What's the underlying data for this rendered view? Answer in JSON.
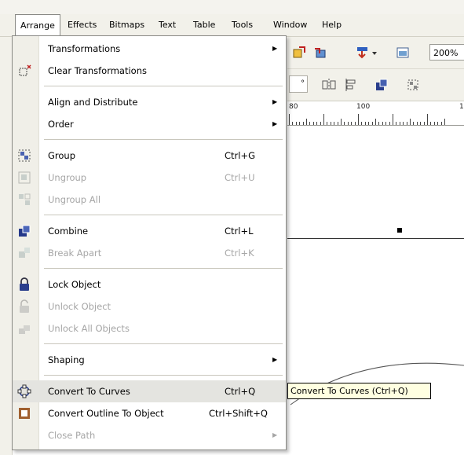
{
  "menubar": {
    "items": [
      {
        "label": "Arrange",
        "active": true
      },
      {
        "label": "Effects",
        "active": false
      },
      {
        "label": "Bitmaps",
        "active": false
      },
      {
        "label": "Text",
        "active": false
      },
      {
        "label": "Table",
        "active": false
      },
      {
        "label": "Tools",
        "active": false
      },
      {
        "label": "Window",
        "active": false
      },
      {
        "label": "Help",
        "active": false
      }
    ]
  },
  "toolbar": {
    "zoom_value": "200%",
    "angle_suffix": "°"
  },
  "ruler": {
    "labels": [
      "80",
      "100",
      "1"
    ]
  },
  "arrange_menu": {
    "transformations": {
      "label": "Transformations",
      "submenu": true,
      "enabled": true
    },
    "clear_transformations": {
      "label": "Clear Transformations",
      "enabled": true
    },
    "align_and_distribute": {
      "label": "Align and Distribute",
      "submenu": true,
      "enabled": true
    },
    "order": {
      "label": "Order",
      "submenu": true,
      "enabled": true
    },
    "group": {
      "label": "Group",
      "shortcut": "Ctrl+G",
      "enabled": true
    },
    "ungroup": {
      "label": "Ungroup",
      "shortcut": "Ctrl+U",
      "enabled": false
    },
    "ungroup_all": {
      "label": "Ungroup All",
      "enabled": false
    },
    "combine": {
      "label": "Combine",
      "shortcut": "Ctrl+L",
      "enabled": true
    },
    "break_apart": {
      "label": "Break Apart",
      "shortcut": "Ctrl+K",
      "enabled": false
    },
    "lock_object": {
      "label": "Lock Object",
      "enabled": true
    },
    "unlock_object": {
      "label": "Unlock Object",
      "enabled": false
    },
    "unlock_all_objects": {
      "label": "Unlock All Objects",
      "enabled": false
    },
    "shaping": {
      "label": "Shaping",
      "submenu": true,
      "enabled": true
    },
    "convert_to_curves": {
      "label": "Convert To Curves",
      "shortcut": "Ctrl+Q",
      "enabled": true,
      "highlighted": true
    },
    "convert_outline_to_object": {
      "label": "Convert Outline To Object",
      "shortcut": "Ctrl+Shift+Q",
      "enabled": true
    },
    "close_path": {
      "label": "Close Path",
      "submenu": true,
      "enabled": false
    }
  },
  "tooltip": {
    "text": "Convert To Curves (Ctrl+Q)"
  },
  "colors": {
    "menu_bg": "#ffffff",
    "gutter_bg": "#f0efe8",
    "highlight": "#e4e4e0",
    "disabled_text": "#a6a6a6",
    "tooltip_bg": "#ffffe1"
  }
}
